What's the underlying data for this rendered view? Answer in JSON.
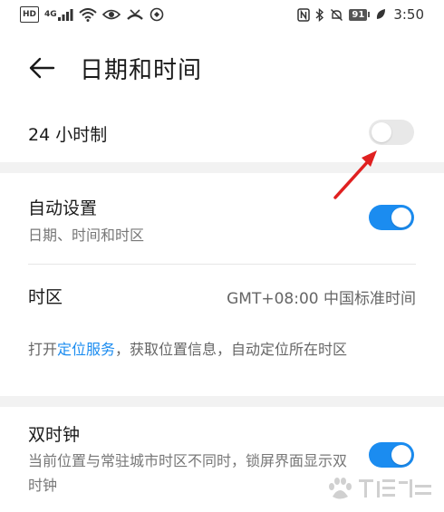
{
  "status_bar": {
    "left_icons": [
      "hd-icon",
      "4g-signal-icon",
      "wifi-icon",
      "eye-icon",
      "missed-call-icon",
      "vpn-icon"
    ],
    "hd_label": "HD",
    "network_label": "4G",
    "right_icons": [
      "nfc-icon",
      "bluetooth-icon",
      "mute-bell-icon",
      "battery-icon",
      "leaf-icon"
    ],
    "battery_level": "91",
    "time": "3:50"
  },
  "header": {
    "title": "日期和时间"
  },
  "settings": {
    "hour24": {
      "label": "24 小时制",
      "enabled": false
    },
    "auto": {
      "label": "自动设置",
      "sublabel": "日期、时间和时区",
      "enabled": true
    },
    "timezone": {
      "label": "时区",
      "value": "GMT+08:00 中国标准时间"
    },
    "info": {
      "prefix": "打开",
      "link": "定位服务",
      "suffix": "，获取位置信息，自动定位所在时区"
    },
    "dual_clock": {
      "label": "双时钟",
      "sublabel": "当前位置与常驻城市时区不同时，锁屏界面显示双时钟",
      "enabled": true
    }
  },
  "colors": {
    "accent": "#1b8cf0",
    "toggle_off": "#e8e8e8",
    "annotation": "#e02020"
  }
}
